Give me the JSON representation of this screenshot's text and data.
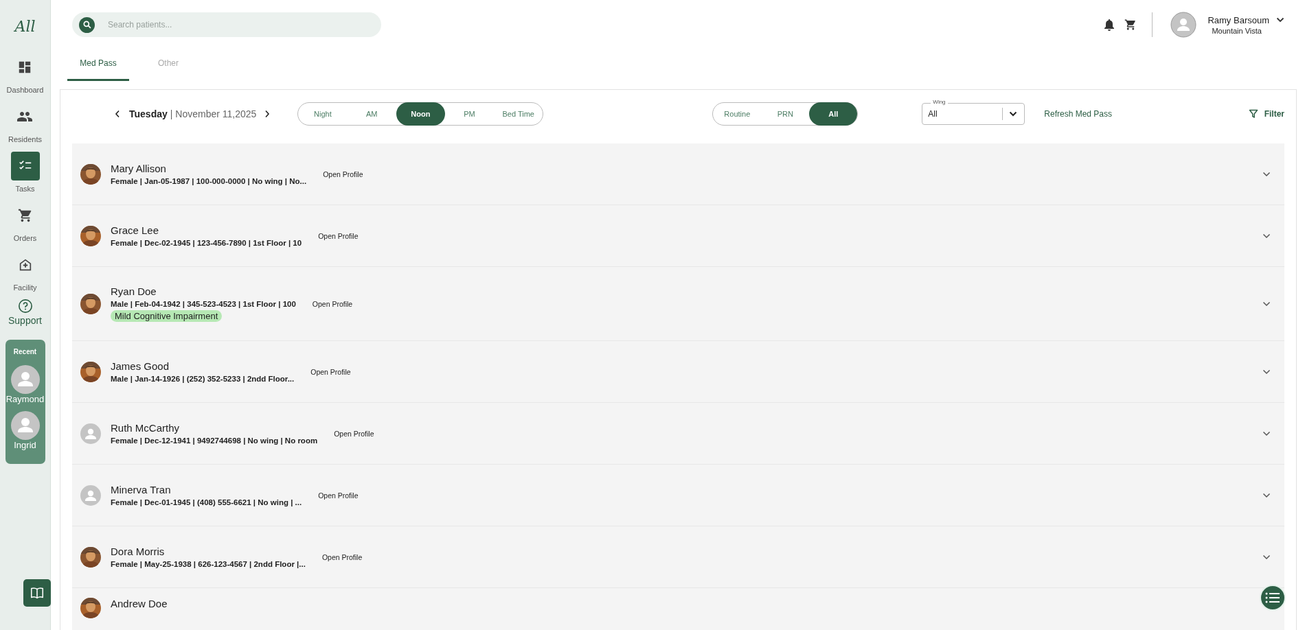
{
  "sidebar": {
    "logo": "All",
    "nav": [
      {
        "label": "Dashboard",
        "selected": false
      },
      {
        "label": "Residents",
        "selected": false
      },
      {
        "label": "Tasks",
        "selected": true
      },
      {
        "label": "Orders",
        "selected": false
      },
      {
        "label": "Facility",
        "selected": false
      }
    ],
    "support": {
      "label": "Support"
    },
    "recent": {
      "title": "Recent",
      "people": [
        {
          "name": "Raymond"
        },
        {
          "name": "Ingrid"
        }
      ]
    }
  },
  "header": {
    "search": {
      "placeholder": "Search patients..."
    },
    "user": {
      "name": "Ramy Barsoum",
      "facility": "Mountain Vista"
    }
  },
  "tabs": [
    {
      "label": "Med Pass",
      "selected": true
    },
    {
      "label": "Other",
      "selected": false
    }
  ],
  "toolbar": {
    "day": "Tuesday",
    "date": "| November 11,2025",
    "shifts": [
      {
        "label": "Night",
        "selected": false
      },
      {
        "label": "AM",
        "selected": false
      },
      {
        "label": "Noon",
        "selected": true
      },
      {
        "label": "PM",
        "selected": false
      },
      {
        "label": "Bed Time",
        "selected": false
      }
    ],
    "types": [
      {
        "label": "Routine",
        "selected": false
      },
      {
        "label": "PRN",
        "selected": false
      },
      {
        "label": "All",
        "selected": true
      }
    ],
    "wing": {
      "label": "Wing",
      "value": "All"
    },
    "refresh": "Refresh Med Pass",
    "filter": "Filter"
  },
  "residents": [
    {
      "name": "Mary Allison",
      "details": "Female | Jan-05-1987 | 100-000-0000 | No wing | No...",
      "action": "Open Profile"
    },
    {
      "name": "Grace Lee",
      "details": "Female | Dec-02-1945 | 123-456-7890 | 1st Floor | 10",
      "action": "Open Profile"
    },
    {
      "name": "Ryan Doe",
      "details": "Male | Feb-04-1942 | 345-523-4523 | 1st Floor | 100",
      "tag": "Mild Cognitive Impairment",
      "action": "Open Profile"
    },
    {
      "name": "James Good",
      "details": "Male | Jan-14-1926 | (252) 352-5233 | 2ndd Floor...",
      "action": "Open Profile"
    },
    {
      "name": "Ruth McCarthy",
      "details": "Female | Dec-12-1941 | 9492744698 | No wing | No room",
      "avatar": {
        "kind": "placeholder"
      },
      "action": "Open Profile"
    },
    {
      "name": "Minerva Tran",
      "details": "Female | Dec-01-1945 | (408) 555-6621 | No wing | ...",
      "avatar": {
        "kind": "placeholder"
      },
      "action": "Open Profile"
    },
    {
      "name": "Dora Morris",
      "details": "Female | May-25-1938 | 626-123-4567 | 2ndd Floor |...",
      "action": "Open Profile"
    },
    {
      "name": "Andrew Doe"
    }
  ]
}
